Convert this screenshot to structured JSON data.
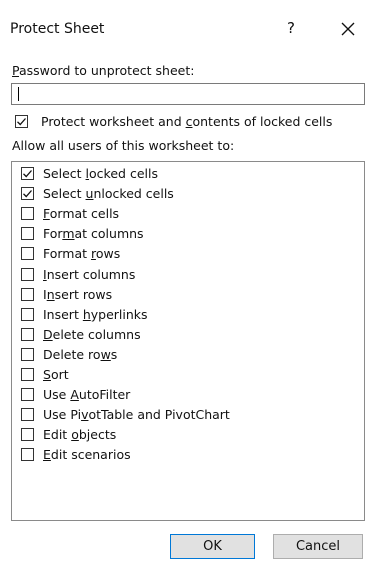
{
  "dialog": {
    "title": "Protect Sheet",
    "help_glyph": "?",
    "password_label": [
      "",
      "P",
      "assword to unprotect sheet:"
    ],
    "password_value": "",
    "protect_contents": {
      "checked": true,
      "label": [
        "Protect worksheet and ",
        "c",
        "ontents of locked cells"
      ]
    },
    "allow_label": "Allow all users of this worksheet to:",
    "permissions": [
      {
        "checked": true,
        "label": [
          "Select ",
          "l",
          "ocked cells"
        ]
      },
      {
        "checked": true,
        "label": [
          "Select ",
          "u",
          "nlocked cells"
        ]
      },
      {
        "checked": false,
        "label": [
          "",
          "F",
          "ormat cells"
        ]
      },
      {
        "checked": false,
        "label": [
          "For",
          "m",
          "at columns"
        ]
      },
      {
        "checked": false,
        "label": [
          "Format ",
          "r",
          "ows"
        ]
      },
      {
        "checked": false,
        "label": [
          "",
          "I",
          "nsert columns"
        ]
      },
      {
        "checked": false,
        "label": [
          "I",
          "n",
          "sert rows"
        ]
      },
      {
        "checked": false,
        "label": [
          "Insert ",
          "h",
          "yperlinks"
        ]
      },
      {
        "checked": false,
        "label": [
          "",
          "D",
          "elete columns"
        ]
      },
      {
        "checked": false,
        "label": [
          "Delete ro",
          "w",
          "s"
        ]
      },
      {
        "checked": false,
        "label": [
          "",
          "S",
          "ort"
        ]
      },
      {
        "checked": false,
        "label": [
          "Use ",
          "A",
          "utoFilter"
        ]
      },
      {
        "checked": false,
        "label": [
          "Use Pi",
          "v",
          "otTable and PivotChart"
        ]
      },
      {
        "checked": false,
        "label": [
          "Edit ",
          "o",
          "bjects"
        ]
      },
      {
        "checked": false,
        "label": [
          "",
          "E",
          "dit scenarios"
        ]
      }
    ],
    "ok_label": "OK",
    "cancel_label": "Cancel"
  }
}
